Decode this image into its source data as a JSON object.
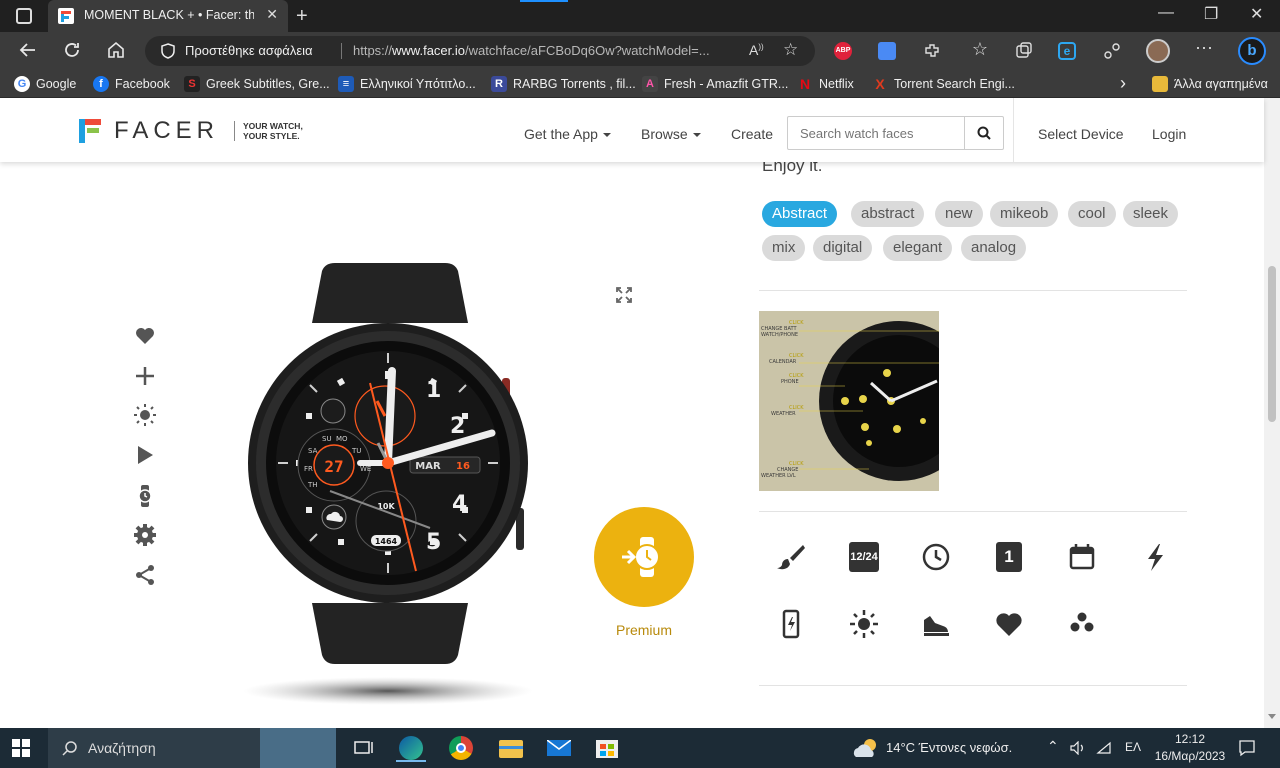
{
  "browser": {
    "tab": {
      "title": "MOMENT BLACK + • Facer: the w",
      "close": "✕"
    },
    "new_tab": "+",
    "window": {
      "minimize": "—",
      "maximize": "❐",
      "close": "✕"
    },
    "address": {
      "secure_label": "Προστέθηκε ασφάλεια",
      "url_prefix": "https://",
      "url_domain": "www.facer.io",
      "url_rest": "/watchface/aFCBoDq6Ow?watchModel=..."
    },
    "toolbar_icons": [
      "back-icon",
      "refresh-icon",
      "home-icon",
      "read-aloud-icon",
      "favorite-add-icon",
      "adblock-icon",
      "translate-icon",
      "extensions-icon",
      "favorites-icon",
      "collections-icon",
      "ie-mode-icon",
      "share-icon",
      "profile-avatar",
      "more-icon",
      "bing-icon"
    ],
    "adblock_label": "ABP",
    "bookmarks": [
      {
        "label": "Google",
        "icon": "G",
        "color": "#ffffff"
      },
      {
        "label": "Facebook",
        "icon": "f",
        "color": "#1877f2"
      },
      {
        "label": "Greek Subtitles, Gre...",
        "icon": "S",
        "color": "#c0392b"
      },
      {
        "label": "Ελληνικοί Υπότιτλο...",
        "icon": "≡",
        "color": "#1e5bb8"
      },
      {
        "label": "RARBG Torrents , fil...",
        "icon": "R",
        "color": "#3b4a9a"
      },
      {
        "label": "Fresh - Amazfit GTR...",
        "icon": "A",
        "color": "#444444"
      },
      {
        "label": "Netflix",
        "icon": "N",
        "color": "#e50914"
      },
      {
        "label": "Torrent Search Engi...",
        "icon": "X",
        "color": "#e03a1e"
      }
    ],
    "other_bookmarks": "Άλλα αγαπημένα",
    "chevron": "›"
  },
  "site": {
    "logo_text": "FACER",
    "tagline_1": "YOUR WATCH,",
    "tagline_2": "YOUR STYLE.",
    "nav": {
      "get_app": "Get the App",
      "browse": "Browse",
      "create": "Create",
      "select_device": "Select Device",
      "login": "Login"
    },
    "search_placeholder": "Search watch faces"
  },
  "watchface": {
    "enjoy_text": "Enjoy it.",
    "tags": [
      "Abstract",
      "abstract",
      "new",
      "mikeob",
      "cool",
      "sleek",
      "mix",
      "digital",
      "elegant",
      "analog"
    ],
    "side_actions": [
      "heart-icon",
      "add-icon",
      "brightness-icon",
      "play-icon",
      "watch-icon",
      "settings-icon",
      "share-icon"
    ],
    "premium_label": "Premium",
    "face": {
      "day": "27",
      "month": "MAR",
      "date": "16",
      "steps_label": "10K",
      "steps": "1464",
      "days": [
        "SU",
        "MO",
        "SA",
        "TU",
        "FR",
        "WE",
        "TH"
      ],
      "accent": "#ff5a1f"
    },
    "preview_labels": [
      "CLICK",
      "CHANGE BATT",
      "WATCH/PHONE",
      "CLICK",
      "CALENDAR",
      "CLICK",
      "PHONE",
      "CLICK",
      "WEATHER",
      "CLICK",
      "CHANGE",
      "WEATHER LVL"
    ],
    "features": [
      "brush-icon",
      "12-24-icon",
      "clock-icon",
      "date-icon",
      "calendar-icon",
      "flash-icon",
      "phone-battery-icon",
      "sun-icon",
      "steps-icon",
      "heart-rate-icon",
      "more-dots-icon"
    ],
    "feature_date_number": "1",
    "feature_1224_label": "12/24"
  },
  "taskbar": {
    "search_text": "Αναζήτηση",
    "weather": "14°C  Έντονες νεφώσ.",
    "language": "ΕΛ",
    "time": "12:12",
    "date": "16/Μαρ/2023"
  }
}
